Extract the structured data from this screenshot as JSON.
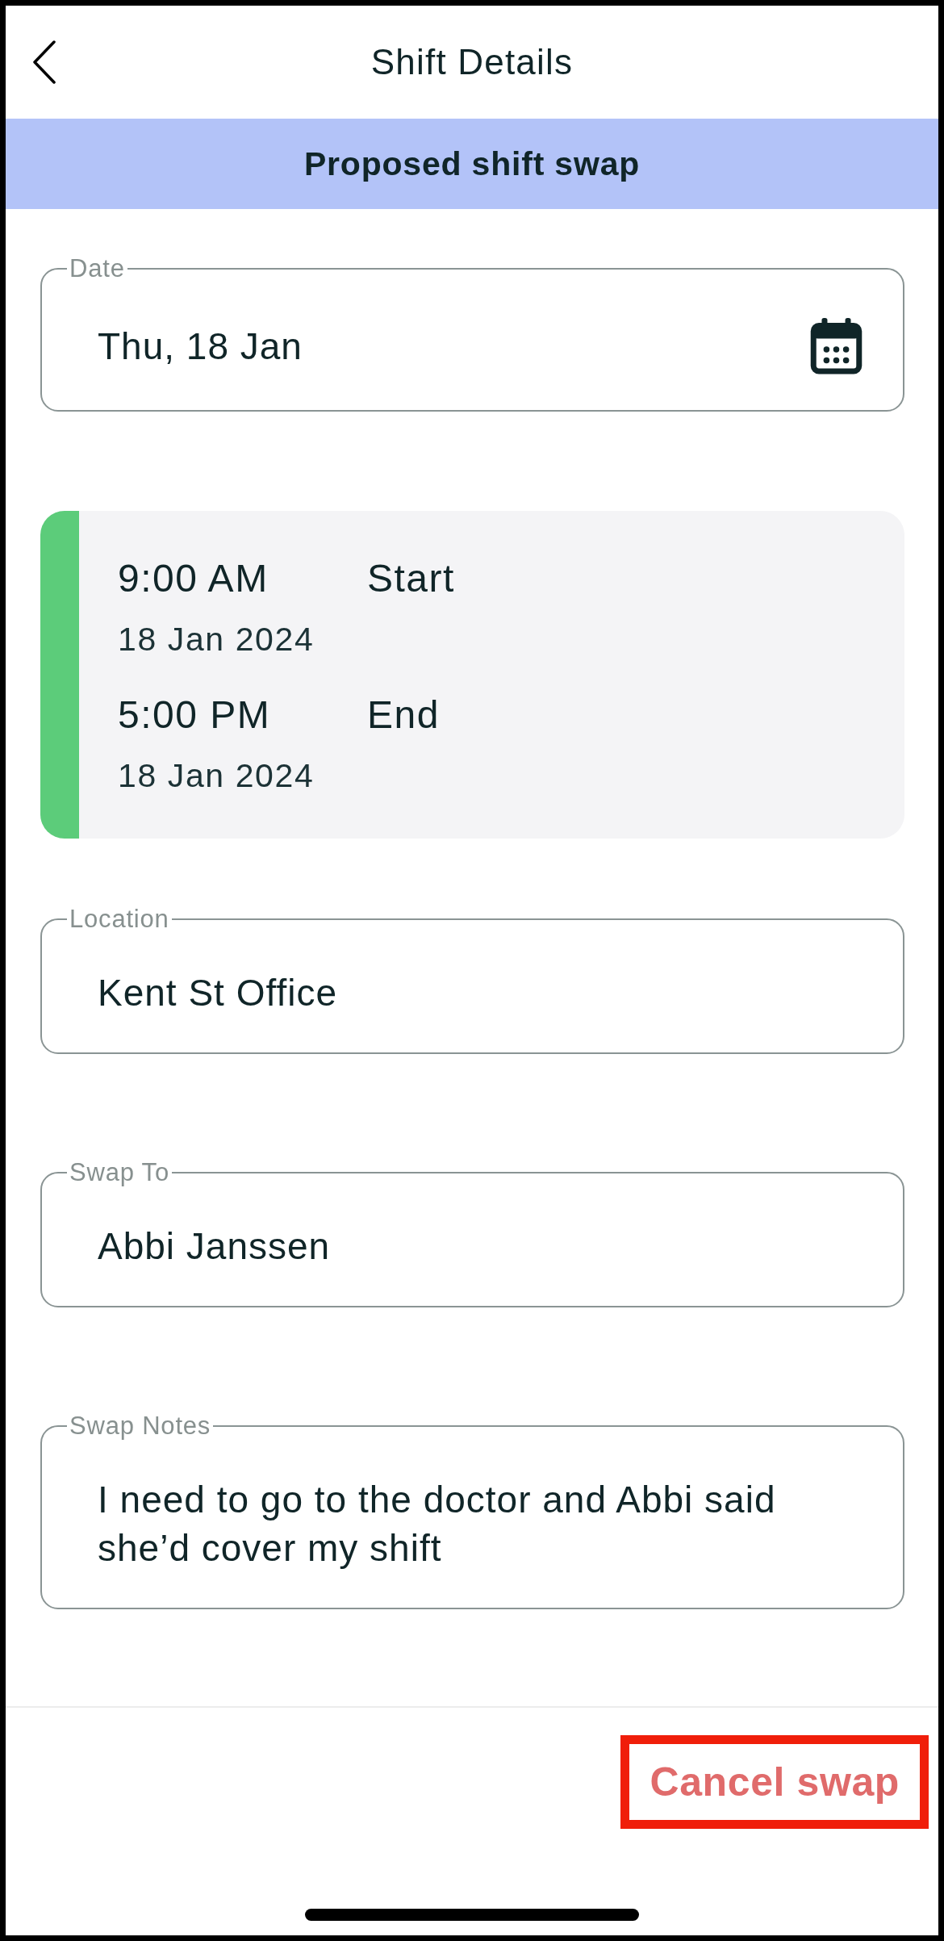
{
  "header": {
    "title": "Shift Details"
  },
  "banner": {
    "text": "Proposed shift swap"
  },
  "date_field": {
    "label": "Date",
    "value": "Thu, 18 Jan"
  },
  "shift": {
    "entries": [
      {
        "time": "9:00 AM",
        "label": "Start",
        "date": "18 Jan 2024"
      },
      {
        "time": "5:00 PM",
        "label": "End",
        "date": "18 Jan 2024"
      }
    ]
  },
  "fields": [
    {
      "label": "Location",
      "value": "Kent St Office"
    },
    {
      "label": "Swap To",
      "value": "Abbi Janssen"
    },
    {
      "label": "Swap Notes",
      "value": "I need to go to the doctor and Abbi said she’d cover my shift"
    }
  ],
  "footer": {
    "action": {
      "label": "Cancel swap",
      "highlighted": true
    }
  }
}
